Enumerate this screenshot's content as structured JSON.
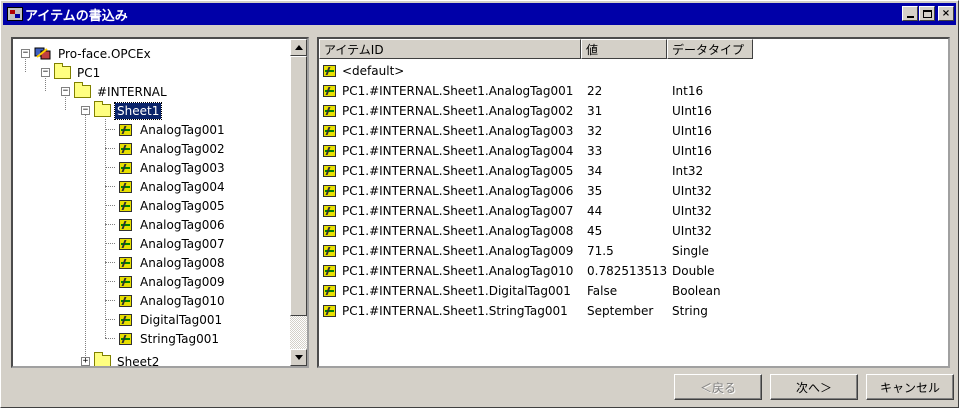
{
  "window": {
    "title": "アイテムの書込み",
    "min_label": "_",
    "max_label": "□",
    "close_label": "×"
  },
  "tree": {
    "root": {
      "label": "Pro-face.OPCEx",
      "expander": "−"
    },
    "pc1": {
      "label": "PC1",
      "expander": "−"
    },
    "internal": {
      "label": "#INTERNAL",
      "expander": "−"
    },
    "sheet1": {
      "label": "Sheet1",
      "expander": "−"
    },
    "tags": [
      "AnalogTag001",
      "AnalogTag002",
      "AnalogTag003",
      "AnalogTag004",
      "AnalogTag005",
      "AnalogTag006",
      "AnalogTag007",
      "AnalogTag008",
      "AnalogTag009",
      "AnalogTag010",
      "DigitalTag001",
      "StringTag001"
    ],
    "sheet2": {
      "label": "Sheet2",
      "expander": "+"
    }
  },
  "list": {
    "columns": [
      "アイテムID",
      "値",
      "データタイプ"
    ],
    "default_row": "<default>",
    "rows": [
      {
        "id": "PC1.#INTERNAL.Sheet1.AnalogTag001",
        "value": "22",
        "type": "Int16"
      },
      {
        "id": "PC1.#INTERNAL.Sheet1.AnalogTag002",
        "value": "31",
        "type": "UInt16"
      },
      {
        "id": "PC1.#INTERNAL.Sheet1.AnalogTag003",
        "value": "32",
        "type": "UInt16"
      },
      {
        "id": "PC1.#INTERNAL.Sheet1.AnalogTag004",
        "value": "33",
        "type": "UInt16"
      },
      {
        "id": "PC1.#INTERNAL.Sheet1.AnalogTag005",
        "value": "34",
        "type": "Int32"
      },
      {
        "id": "PC1.#INTERNAL.Sheet1.AnalogTag006",
        "value": "35",
        "type": "UInt32"
      },
      {
        "id": "PC1.#INTERNAL.Sheet1.AnalogTag007",
        "value": "44",
        "type": "UInt32"
      },
      {
        "id": "PC1.#INTERNAL.Sheet1.AnalogTag008",
        "value": "45",
        "type": "UInt32"
      },
      {
        "id": "PC1.#INTERNAL.Sheet1.AnalogTag009",
        "value": "71.5",
        "type": "Single"
      },
      {
        "id": "PC1.#INTERNAL.Sheet1.AnalogTag010",
        "value": "0.782513513",
        "type": "Double"
      },
      {
        "id": "PC1.#INTERNAL.Sheet1.DigitalTag001",
        "value": "False",
        "type": "Boolean"
      },
      {
        "id": "PC1.#INTERNAL.Sheet1.StringTag001",
        "value": "September",
        "type": "String"
      }
    ]
  },
  "buttons": {
    "back": "＜戻る",
    "next": "次へ＞",
    "cancel": "キャンセル"
  },
  "colors": {
    "titlebar": "#0000a8",
    "selection": "#0a246a",
    "face": "#d4d0c8"
  },
  "icons": {
    "app": "app-logo-icon",
    "server": "opc-server-icon",
    "folder": "folder-icon",
    "tag": "tag-icon"
  }
}
